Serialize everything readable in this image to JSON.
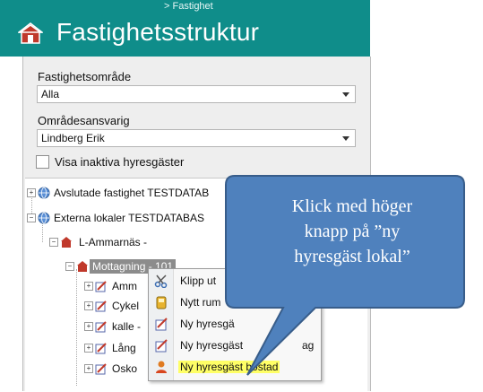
{
  "header": {
    "breadcrumb": "> Fastighet",
    "title": "Fastighetsstruktur",
    "logo_icon": "house-icon"
  },
  "filters": {
    "area_label": "Fastighetsområde",
    "area_value": "Alla",
    "manager_label": "Områdesansvarig",
    "manager_value": "Lindberg Erik",
    "inactive_label": "Visa inaktiva hyresgäster",
    "inactive_checked": false
  },
  "tree": {
    "nodes": [
      {
        "label": "Avslutade fastighet TESTDATAB",
        "icon": "globe-icon"
      },
      {
        "label": "Externa lokaler TESTDATABAS",
        "icon": "globe-icon"
      },
      {
        "label": "L-Ammarnäs -",
        "icon": "house-icon"
      },
      {
        "label": "Mottagning - 101",
        "icon": "house-icon"
      },
      {
        "label": "Amm",
        "icon": "lease-icon"
      },
      {
        "label": "Cykel",
        "icon": "lease-icon"
      },
      {
        "label": "kalle -",
        "icon": "lease-icon"
      },
      {
        "label": "Lång",
        "icon": "lease-icon"
      },
      {
        "label": "Osko",
        "icon": "lease-icon"
      }
    ]
  },
  "context_menu": {
    "items": [
      {
        "label": "Klipp ut",
        "icon": "scissors-icon"
      },
      {
        "label": "Nytt rum",
        "icon": "room-icon"
      },
      {
        "label": "Ny hyresgä",
        "icon": "lease-icon"
      },
      {
        "label": "Ny hyresgäst",
        "icon": "lease-icon"
      },
      {
        "label": "Ny hyresgäst bostad",
        "icon": "person-icon"
      }
    ],
    "fragment_right": "ag"
  },
  "callout": {
    "line1": "Klick med höger",
    "line2": "knapp på ”ny",
    "line3": "hyresgäst lokal”"
  },
  "colors": {
    "header_bg": "#0f8d8a",
    "callout_fill": "#4f81bd",
    "highlight": "#ffff66"
  }
}
